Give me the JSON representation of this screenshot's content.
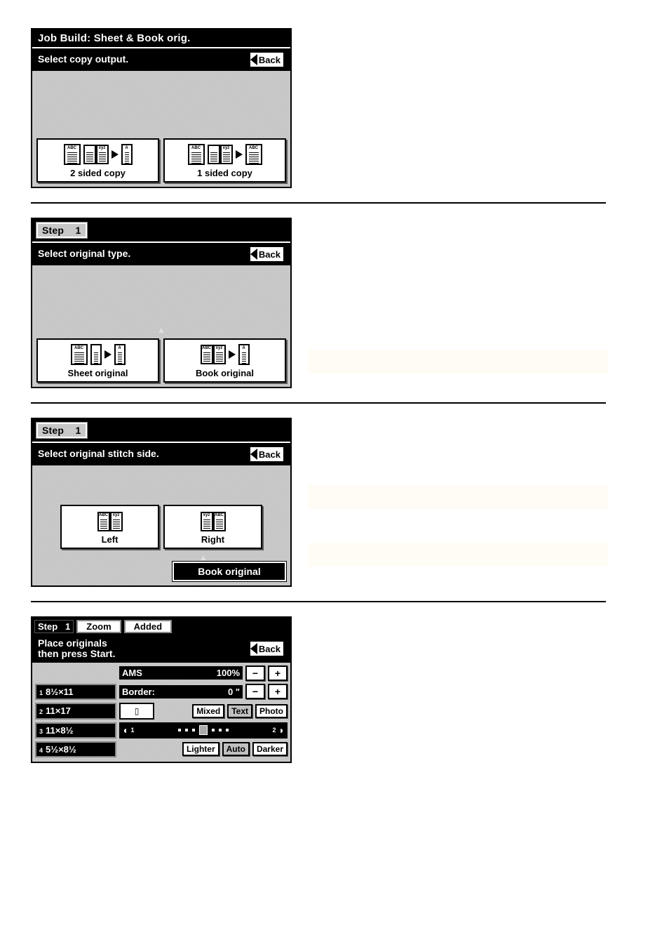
{
  "screen1": {
    "title": "Job Build: Sheet & Book orig.",
    "subtitle": "Select copy output.",
    "back": "Back",
    "option1": "2 sided copy",
    "option2": "1 sided copy"
  },
  "screen2": {
    "step_label": "Step",
    "step_num": "1",
    "subtitle": "Select original type.",
    "back": "Back",
    "option1": "Sheet original",
    "option2": "Book original"
  },
  "screen3": {
    "step_label": "Step",
    "step_num": "1",
    "subtitle": "Select original stitch side.",
    "back": "Back",
    "option1": "Left",
    "option2": "Right",
    "footer_tab": "Book original"
  },
  "screen4": {
    "step_label": "Step",
    "step_num": "1",
    "tab_zoom": "Zoom",
    "tab_added": "Added",
    "subtitle": "Place originals\nthen press Start.",
    "back": "Back",
    "ams_label": "AMS",
    "ams_value": "100%",
    "border_label": "Border:",
    "border_value": "0 \"",
    "minus": "−",
    "plus": "+",
    "paper1": "8½×11",
    "paper2": "11×17",
    "paper3": "11×8½",
    "paper4": "5½×8½",
    "mixed": "Mixed",
    "text": "Text",
    "photo": "Photo",
    "lighter": "Lighter",
    "auto": "Auto",
    "darker": "Darker",
    "slider_left_num": "1",
    "slider_right_num": "2"
  }
}
